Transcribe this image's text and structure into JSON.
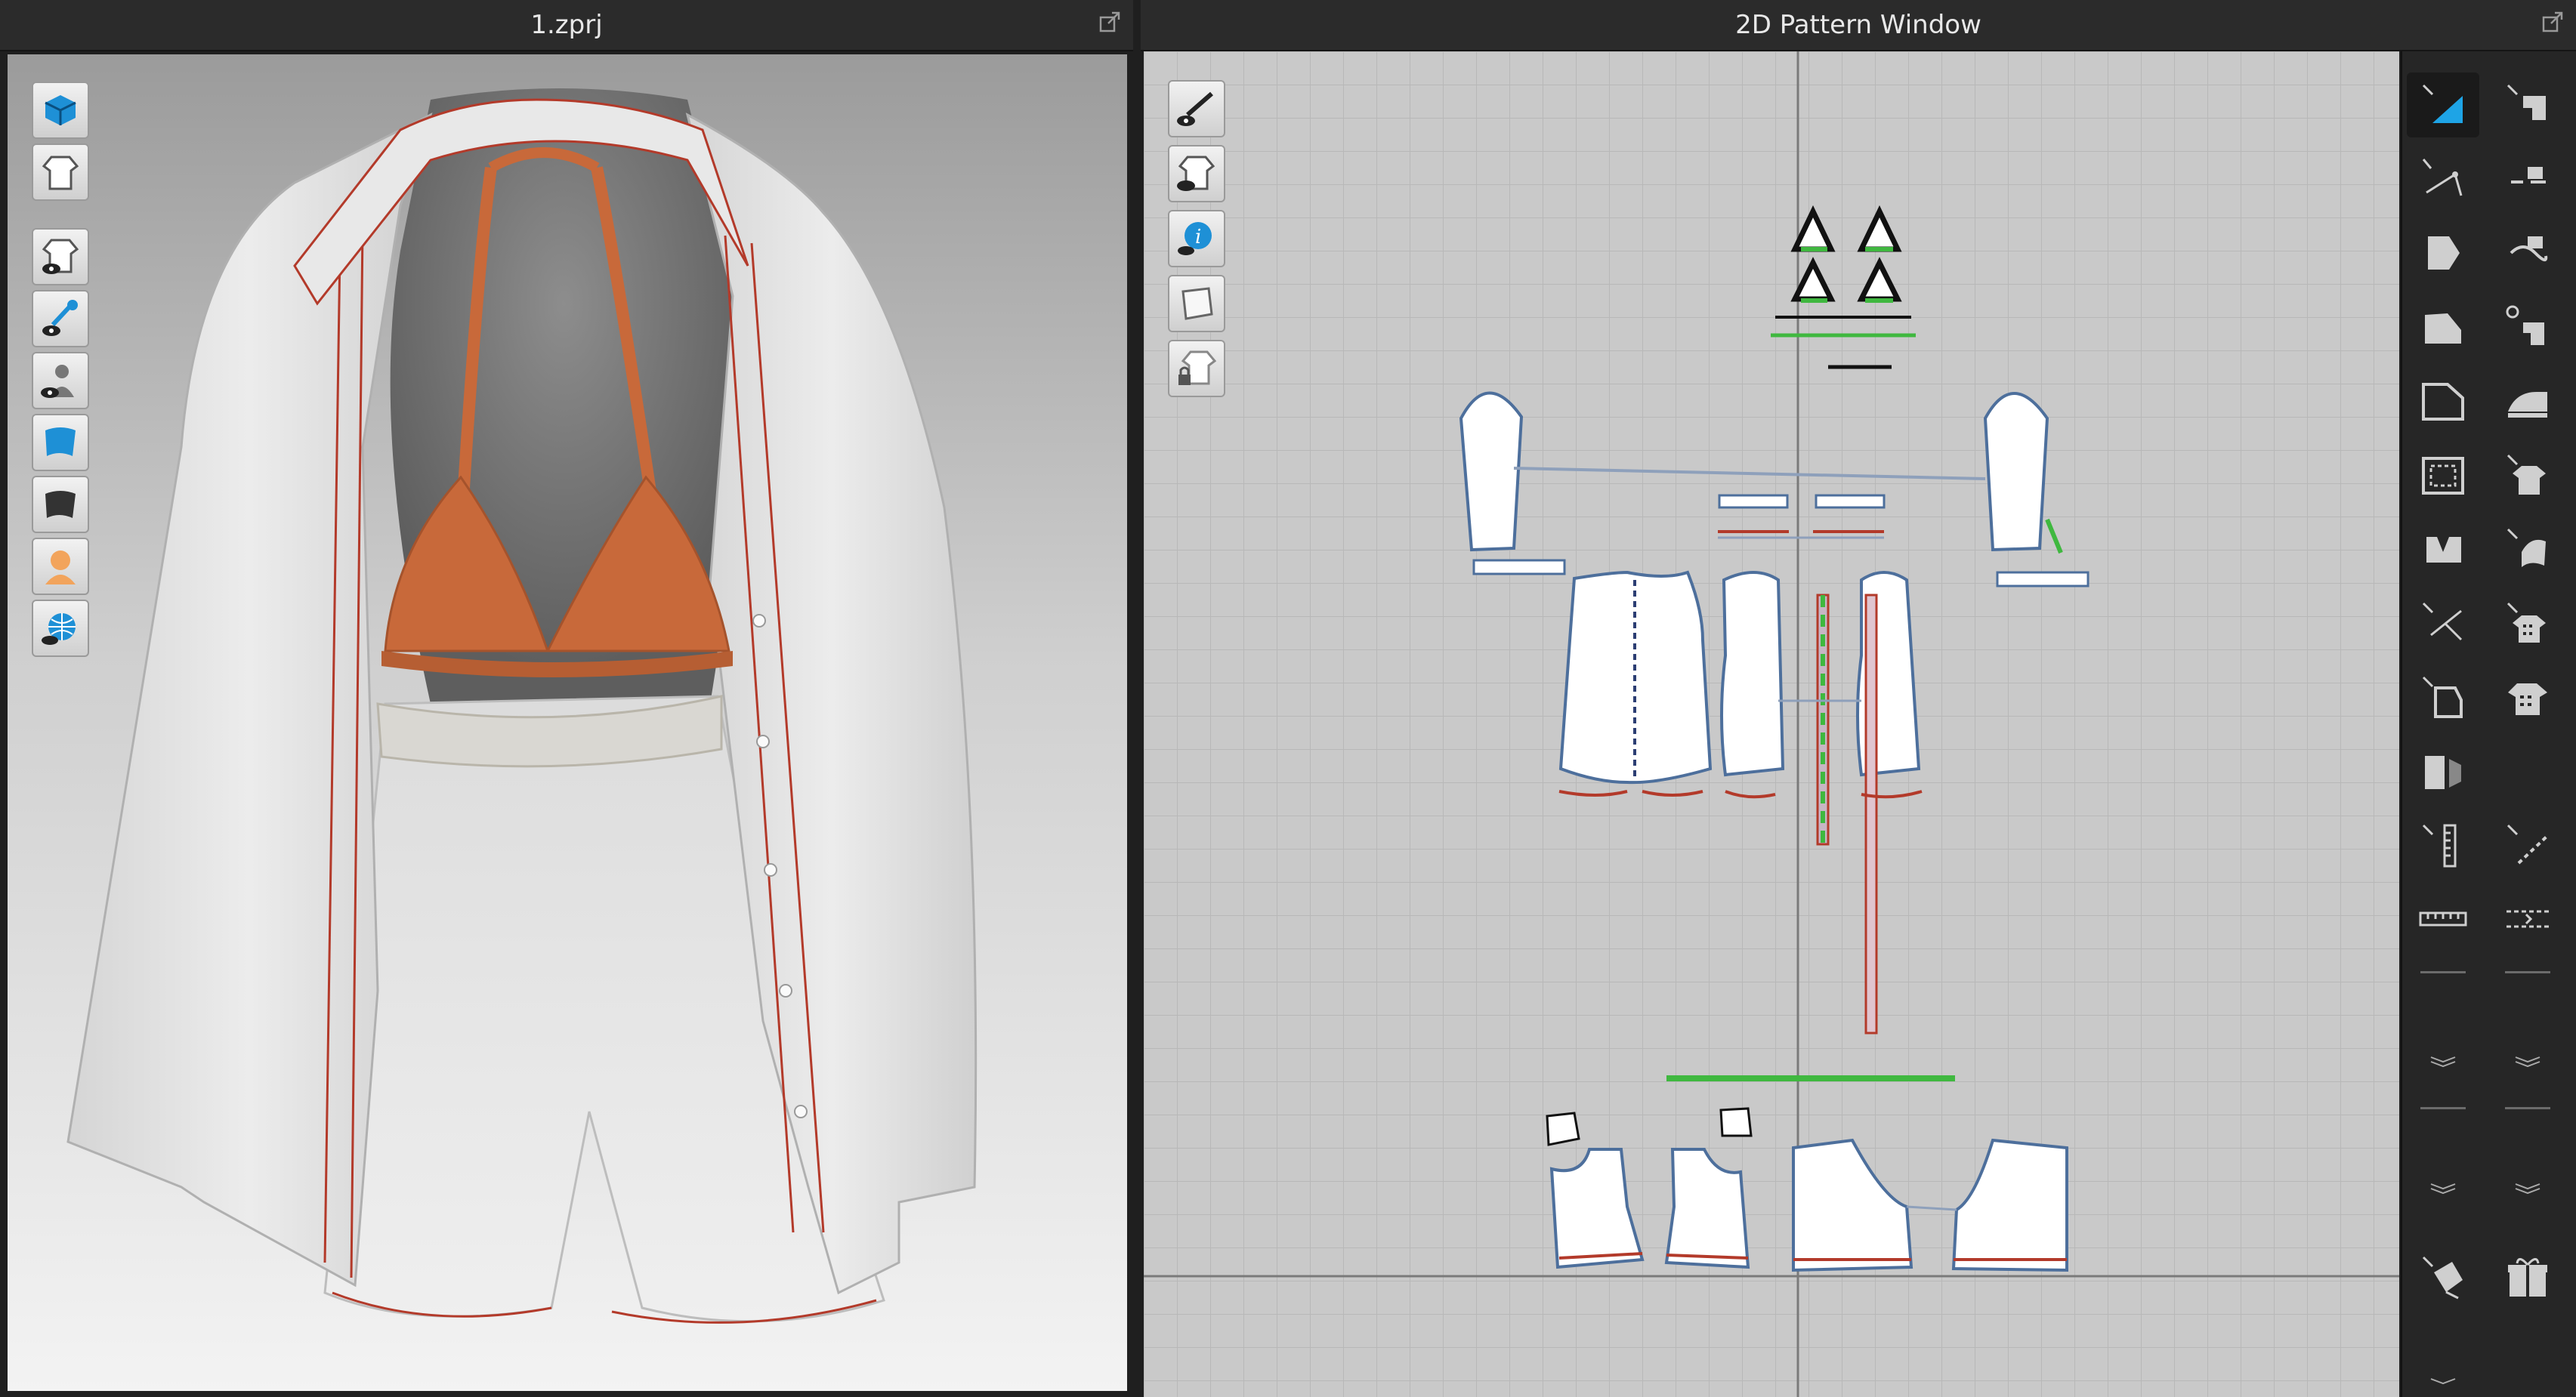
{
  "left_panel": {
    "title": "1.zprj"
  },
  "right_panel": {
    "title": "2D Pattern Window"
  },
  "viewport3d_tools": [
    {
      "name": "simulation-icon"
    },
    {
      "name": "avatar-garment-icon"
    },
    {
      "name": "show-garment-icon"
    },
    {
      "name": "show-pins-icon"
    },
    {
      "name": "show-avatar-icon"
    },
    {
      "name": "texture-view-icon"
    },
    {
      "name": "shaded-view-icon"
    },
    {
      "name": "avatar-skin-icon"
    },
    {
      "name": "environment-icon"
    }
  ],
  "viewport2d_tools": [
    {
      "name": "show-baseline-icon"
    },
    {
      "name": "show-pattern-icon"
    },
    {
      "name": "info-icon"
    },
    {
      "name": "texture-icon"
    },
    {
      "name": "lock-pattern-icon"
    }
  ],
  "colors": {
    "orange_fabric": "#c8693a",
    "shirt_fabric": "#e6e6e6",
    "seam_red": "#b33a2a",
    "seam_green": "#3fb83f",
    "outline_blue": "#4d6f9c",
    "accent_blue": "#1ea4e6"
  }
}
